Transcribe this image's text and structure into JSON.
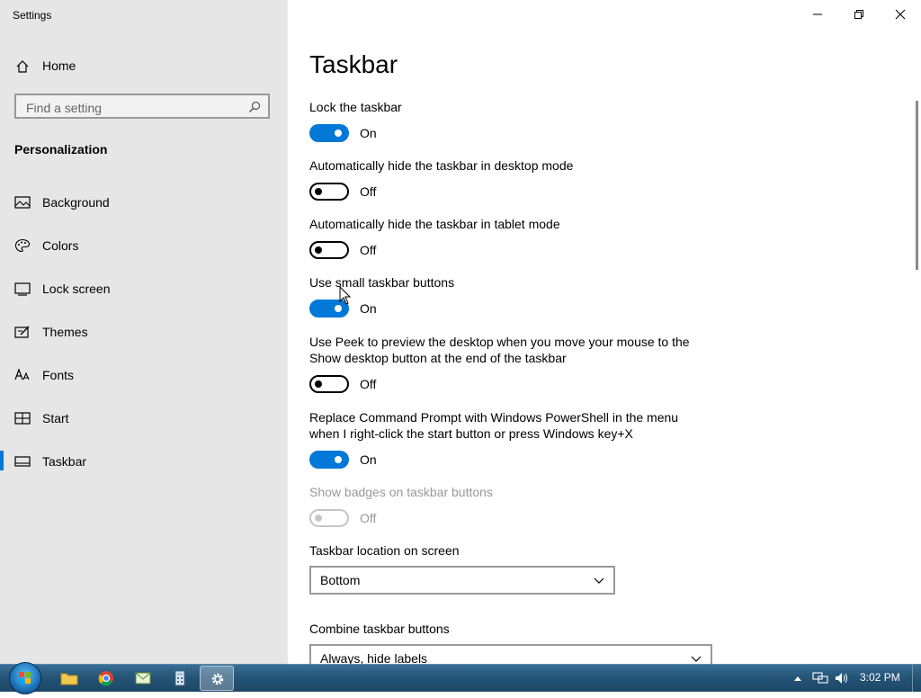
{
  "window": {
    "title": "Settings"
  },
  "sidebar": {
    "home_label": "Home",
    "search_placeholder": "Find a setting",
    "section_title": "Personalization",
    "items": [
      {
        "label": "Background",
        "icon": "picture-icon"
      },
      {
        "label": "Colors",
        "icon": "palette-icon"
      },
      {
        "label": "Lock screen",
        "icon": "lock-screen-icon"
      },
      {
        "label": "Themes",
        "icon": "themes-icon"
      },
      {
        "label": "Fonts",
        "icon": "fonts-icon"
      },
      {
        "label": "Start",
        "icon": "start-icon"
      },
      {
        "label": "Taskbar",
        "icon": "taskbar-icon",
        "selected": true
      }
    ]
  },
  "main": {
    "title": "Taskbar",
    "settings": [
      {
        "label": "Lock the taskbar",
        "state": "On"
      },
      {
        "label": "Automatically hide the taskbar in desktop mode",
        "state": "Off"
      },
      {
        "label": "Automatically hide the taskbar in tablet mode",
        "state": "Off"
      },
      {
        "label": "Use small taskbar buttons",
        "state": "On"
      },
      {
        "label": "Use Peek to preview the desktop when you move your mouse to the Show desktop button at the end of the taskbar",
        "state": "Off"
      },
      {
        "label": "Replace Command Prompt with Windows PowerShell in the menu when I right-click the start button or press Windows key+X",
        "state": "On"
      },
      {
        "label": "Show badges on taskbar buttons",
        "state": "Off",
        "disabled": true
      }
    ],
    "location": {
      "label": "Taskbar location on screen",
      "value": "Bottom"
    },
    "combine": {
      "label": "Combine taskbar buttons",
      "value": "Always, hide labels"
    }
  },
  "taskbar": {
    "pinned": [
      "folder-icon",
      "chrome-icon",
      "mail-icon",
      "calculator-icon",
      "settings-gear-icon"
    ],
    "clock": "3:02 PM"
  },
  "colors": {
    "accent": "#0078d7",
    "sidebar_bg": "#e6e6e6"
  }
}
